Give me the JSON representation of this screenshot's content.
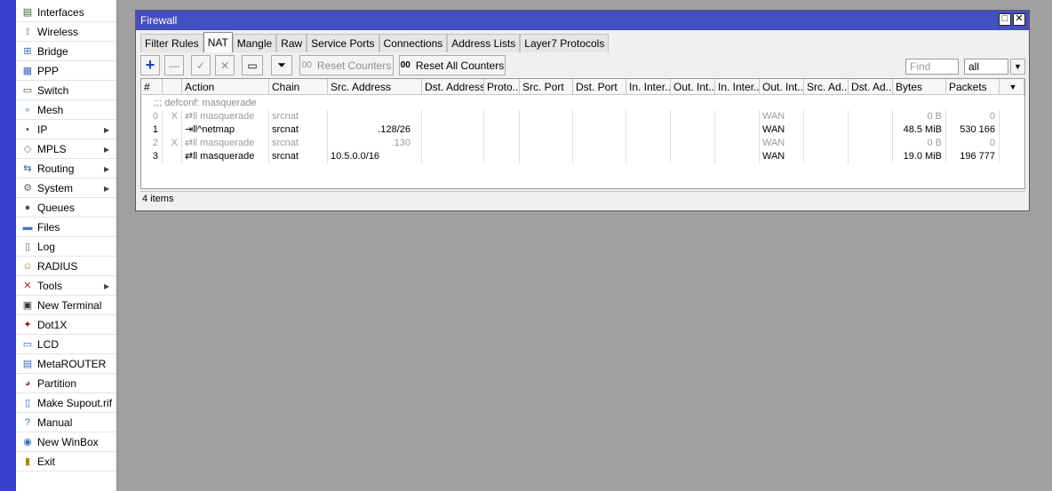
{
  "sidebar": {
    "items": [
      {
        "label": "Interfaces",
        "icon": "interfaces-icon",
        "glyph": "▤",
        "color": "#2a6b2a",
        "submenu": false
      },
      {
        "label": "Wireless",
        "icon": "wireless-icon",
        "glyph": "⟟",
        "color": "#555555",
        "submenu": false
      },
      {
        "label": "Bridge",
        "icon": "bridge-icon",
        "glyph": "⊞",
        "color": "#2b6cb0",
        "submenu": false
      },
      {
        "label": "PPP",
        "icon": "ppp-icon",
        "glyph": "▦",
        "color": "#3a66c4",
        "submenu": false
      },
      {
        "label": "Switch",
        "icon": "switch-icon",
        "glyph": "▭",
        "color": "#444444",
        "submenu": false
      },
      {
        "label": "Mesh",
        "icon": "mesh-icon",
        "glyph": "∘",
        "color": "#2b6cb0",
        "submenu": false
      },
      {
        "label": "IP",
        "icon": "ip-icon",
        "glyph": "▪",
        "color": "#555555",
        "submenu": true
      },
      {
        "label": "MPLS",
        "icon": "mpls-icon",
        "glyph": "◇",
        "color": "#777777",
        "submenu": true
      },
      {
        "label": "Routing",
        "icon": "routing-icon",
        "glyph": "⇆",
        "color": "#2b6cb0",
        "submenu": true
      },
      {
        "label": "System",
        "icon": "system-icon",
        "glyph": "⚙",
        "color": "#666666",
        "submenu": true
      },
      {
        "label": "Queues",
        "icon": "queues-icon",
        "glyph": "●",
        "color": "#555555",
        "submenu": false
      },
      {
        "label": "Files",
        "icon": "files-icon",
        "glyph": "▬",
        "color": "#3a7bd5",
        "submenu": false
      },
      {
        "label": "Log",
        "icon": "log-icon",
        "glyph": "▯",
        "color": "#666666",
        "submenu": false
      },
      {
        "label": "RADIUS",
        "icon": "radius-icon",
        "glyph": "☺",
        "color": "#b8860b",
        "submenu": false
      },
      {
        "label": "Tools",
        "icon": "tools-icon",
        "glyph": "✕",
        "color": "#b22222",
        "submenu": true
      },
      {
        "label": "New Terminal",
        "icon": "terminal-icon",
        "glyph": "▣",
        "color": "#333333",
        "submenu": false
      },
      {
        "label": "Dot1X",
        "icon": "dot1x-icon",
        "glyph": "✦",
        "color": "#a01010",
        "submenu": false
      },
      {
        "label": "LCD",
        "icon": "lcd-icon",
        "glyph": "▭",
        "color": "#2b6cb0",
        "submenu": false
      },
      {
        "label": "MetaROUTER",
        "icon": "metarouter-icon",
        "glyph": "▤",
        "color": "#3a66c4",
        "submenu": false
      },
      {
        "label": "Partition",
        "icon": "partition-icon",
        "glyph": "◕",
        "color": "#d04040",
        "submenu": false
      },
      {
        "label": "Make Supout.rif",
        "icon": "supout-icon",
        "glyph": "▯",
        "color": "#3a66c4",
        "submenu": false
      },
      {
        "label": "Manual",
        "icon": "manual-icon",
        "glyph": "?",
        "color": "#3a66c4",
        "submenu": false
      },
      {
        "label": "New WinBox",
        "icon": "winbox-icon",
        "glyph": "◉",
        "color": "#2b6cb0",
        "submenu": false
      },
      {
        "label": "Exit",
        "icon": "exit-icon",
        "glyph": "▮",
        "color": "#b8860b",
        "submenu": false
      }
    ]
  },
  "window": {
    "title": "Firewall",
    "restore_glyph": "□",
    "close_glyph": "✕"
  },
  "tabs": [
    {
      "label": "Filter Rules",
      "active": false
    },
    {
      "label": "NAT",
      "active": true
    },
    {
      "label": "Mangle",
      "active": false
    },
    {
      "label": "Raw",
      "active": false
    },
    {
      "label": "Service Ports",
      "active": false
    },
    {
      "label": "Connections",
      "active": false
    },
    {
      "label": "Address Lists",
      "active": false
    },
    {
      "label": "Layer7 Protocols",
      "active": false
    }
  ],
  "toolbar": {
    "add_glyph": "+",
    "remove_glyph": "—",
    "enable_glyph": "✓",
    "disable_glyph": "✕",
    "comment_glyph": "▭",
    "filter_glyph": "⏷",
    "reset_counters_prefix": "00",
    "reset_counters_label": "Reset Counters",
    "reset_all_prefix": "00",
    "reset_all_label": "Reset All Counters",
    "find_placeholder": "Find",
    "scope_value": "all",
    "dropdown_glyph": "▼"
  },
  "table": {
    "columns": [
      "#",
      "",
      "Action",
      "Chain",
      "Src. Address",
      "Dst. Address",
      "Proto...",
      "Src. Port",
      "Dst. Port",
      "In. Inter...",
      "Out. Int...",
      "In. Inter...",
      "Out. Int...",
      "Src. Ad...",
      "Dst. Ad...",
      "Bytes",
      "Packets"
    ],
    "comment": ";;; defconf: masquerade",
    "rows": [
      {
        "num": "0",
        "flag": "X",
        "action": "⇄ll masquerade",
        "chain": "srcnat",
        "src": "",
        "out_int": "WAN",
        "bytes": "0 B",
        "packets": "0",
        "disabled": true
      },
      {
        "num": "1",
        "flag": "",
        "action": "⇥ll^netmap",
        "chain": "srcnat",
        "src": ".128/26",
        "out_int": "WAN",
        "bytes": "48.5 MiB",
        "packets": "530 166",
        "disabled": false
      },
      {
        "num": "2",
        "flag": "X",
        "action": "⇄ll masquerade",
        "chain": "srcnat",
        "src": ".130",
        "out_int": "WAN",
        "bytes": "0 B",
        "packets": "0",
        "disabled": true
      },
      {
        "num": "3",
        "flag": "",
        "action": "⇄ll masquerade",
        "chain": "srcnat",
        "src": "10.5.0.0/16",
        "out_int": "WAN",
        "bytes": "19.0 MiB",
        "packets": "196 777",
        "disabled": false
      }
    ]
  },
  "status": {
    "items_count": "4 items"
  },
  "colors": {
    "title_bar": "#4450bf",
    "accent_strip": "#3b3fcf",
    "desktop": "#a0a0a0"
  }
}
